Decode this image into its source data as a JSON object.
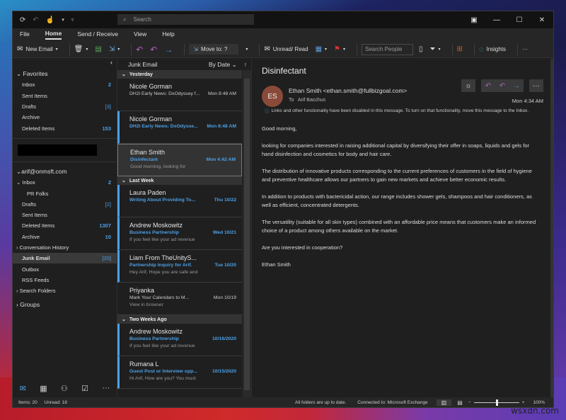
{
  "watermark": "wsxdn.com",
  "titlebar": {
    "search_placeholder": "Search",
    "icons": [
      "sync-icon",
      "undo-icon",
      "touch-mode-icon",
      "chevron-down-icon",
      "customize-icon"
    ]
  },
  "menu": {
    "items": [
      "File",
      "Home",
      "Send / Receive",
      "View",
      "Help"
    ],
    "active": "Home"
  },
  "ribbon": {
    "new_email": "New Email",
    "move_to": "Move to: ?",
    "unread_read": "Unread/ Read",
    "search_people": "Search People",
    "insights": "Insights",
    "more": "···"
  },
  "nav": {
    "favorites_label": "Favorites",
    "favorites": [
      {
        "label": "Inbox",
        "count": "2"
      },
      {
        "label": "Sent Items",
        "count": ""
      },
      {
        "label": "Drafts",
        "count": "[3]"
      },
      {
        "label": "Archive",
        "count": ""
      },
      {
        "label": "Deleted Items",
        "count": "153"
      }
    ],
    "account": "arif@onmsft.com",
    "folders": [
      {
        "label": "Inbox",
        "count": "2"
      },
      {
        "label": "PR Folks",
        "count": ""
      },
      {
        "label": "Drafts",
        "count": "[2]"
      },
      {
        "label": "Sent Items",
        "count": ""
      },
      {
        "label": "Deleted Items",
        "count": "1307"
      },
      {
        "label": "Archive",
        "count": "10"
      },
      {
        "label": "Conversation History",
        "count": ""
      },
      {
        "label": "Junk Email",
        "count": "[20]"
      },
      {
        "label": "Outbox",
        "count": ""
      },
      {
        "label": "RSS Feeds",
        "count": ""
      },
      {
        "label": "Search Folders",
        "count": ""
      }
    ],
    "groups": "Groups"
  },
  "list": {
    "folder": "Junk Email",
    "sort": "By Date",
    "groups": [
      "Yesterday",
      "Last Week",
      "Two Weeks Ago"
    ],
    "items": [
      {
        "from": "Nicole Gorman",
        "subject": "DH2i Early News: DxOdyssey f...",
        "date": "Mon 8:48 AM",
        "preview": ""
      },
      {
        "from": "Nicole Gorman",
        "subject": "DH2i Early News: DxOdysse...",
        "date": "Mon 8:48 AM",
        "preview": ""
      },
      {
        "from": "Ethan Smith",
        "subject": "Disinfectant",
        "date": "Mon 4:42 AM",
        "preview": "Good morning,  looking for"
      },
      {
        "from": "Laura Paden",
        "subject": "Writing About Providing To...",
        "date": "Thu 10/22",
        "preview": ""
      },
      {
        "from": "Andrew Moskowitz",
        "subject": "Business Partnership",
        "date": "Wed 10/21",
        "preview": "If you feel like your ad revenue"
      },
      {
        "from": "Liam From TheUnityS...",
        "subject": "Partnership Inquiry for Arif.",
        "date": "Tue 10/20",
        "preview": "Hey Arif,  Hope you are safe and"
      },
      {
        "from": "Priyanka",
        "subject": "Mark Your Calendars to M...",
        "date": "Mon 10/19",
        "preview": "View in browser"
      },
      {
        "from": "Andrew Moskowitz",
        "subject": "Business Partnership",
        "date": "10/16/2020",
        "preview": "If you feel like your ad revenue"
      },
      {
        "from": "Rumana L",
        "subject": "Guest Post or Interview opp...",
        "date": "10/15/2020",
        "preview": "Hi Arif,  How are you?  You must"
      }
    ]
  },
  "reading": {
    "subject": "Disinfectant",
    "initials": "ES",
    "sender": "Ethan Smith <ethan.smith@fullbizgoal.com>",
    "to_label": "To",
    "to": "Arif Bacchus",
    "time": "Mon 4:34 AM",
    "info": "Links and other functionality have been disabled in this message. To turn on that functionality, move this message to the Inbox.",
    "body": [
      "Good morning,",
      "looking for companies interested in raising additional capital by diversifying their offer in soaps, liquids and gels for hand disinfection and cosmetics for body and hair care.",
      "The distribution of innovative products corresponding to the current preferences of customers in the field of hygiene and preventive healthcare allows our partners to gain new markets and achieve better economic results.",
      "In addition to products with bactericidal action, our range includes shower gels, shampoos and hair conditioners, as well as efficient, concentrated detergents.",
      "The versatility (suitable for all skin types) combined with an affordable price means that customers make an informed choice of a product among others available on the market.",
      "Are you interested in cooperation?",
      "Ethan Smith"
    ]
  },
  "status": {
    "items": "Items: 20",
    "unread": "Unread: 18",
    "sync": "All folders are up to date.",
    "connected": "Connected to: Microsoft Exchange",
    "zoom": "100%",
    "zoom_value": 100
  }
}
